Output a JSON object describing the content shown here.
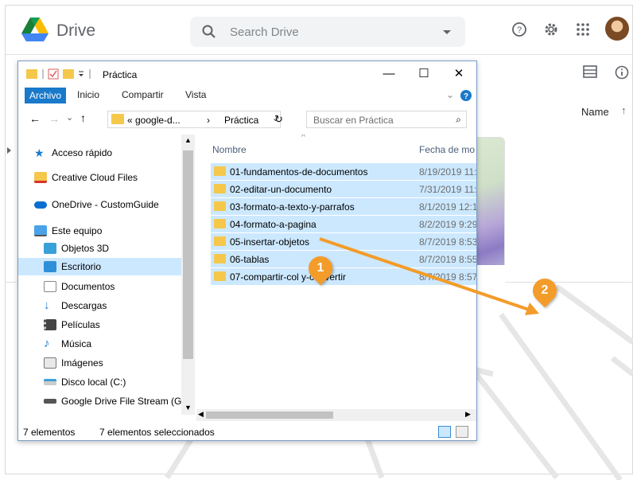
{
  "drive": {
    "title": "Drive",
    "search_placeholder": "Search Drive",
    "name_column": "Name",
    "sort_arrow": "↑"
  },
  "explorer": {
    "title": "Práctica",
    "ribbon_tabs": [
      "Archivo",
      "Inicio",
      "Compartir",
      "Vista"
    ],
    "address_prefix": "« google-d...",
    "address_current": "Práctica",
    "search_placeholder": "Buscar en Práctica",
    "nav_items": [
      {
        "label": "Acceso rápido",
        "icon": "star-icon"
      },
      {
        "label": "Creative Cloud Files",
        "icon": "creative-cloud-icon"
      },
      {
        "label": "OneDrive - CustomGuide",
        "icon": "onedrive-icon"
      },
      {
        "label": "Este equipo",
        "icon": "computer-icon"
      },
      {
        "label": "Objetos 3D",
        "icon": "3d-objects-icon"
      },
      {
        "label": "Escritorio",
        "icon": "desktop-icon"
      },
      {
        "label": "Documentos",
        "icon": "documents-icon"
      },
      {
        "label": "Descargas",
        "icon": "downloads-icon"
      },
      {
        "label": "Películas",
        "icon": "movies-icon"
      },
      {
        "label": "Música",
        "icon": "music-icon"
      },
      {
        "label": "Imágenes",
        "icon": "images-icon"
      },
      {
        "label": "Disco local (C:)",
        "icon": "drive-icon"
      },
      {
        "label": "Google Drive File Stream (G:)",
        "icon": "drive-stream-icon"
      }
    ],
    "columns": {
      "name": "Nombre",
      "date": "Fecha de mo"
    },
    "files": [
      {
        "name": "01-fundamentos-de-documentos",
        "date": "8/19/2019 11:"
      },
      {
        "name": "02-editar-un-documento",
        "date": "7/31/2019 11:"
      },
      {
        "name": "03-formato-a-texto-y-parrafos",
        "date": "8/1/2019 12:1"
      },
      {
        "name": "04-formato-a-pagina",
        "date": "8/2/2019 9:29"
      },
      {
        "name": "05-insertar-objetos",
        "date": "8/7/2019 8:53"
      },
      {
        "name": "06-tablas",
        "date": "8/7/2019 8:55"
      },
      {
        "name": "07-compartir-col        y-convertir",
        "date": "8/7/2019 8:57"
      }
    ],
    "status_count": "7 elementos",
    "status_selected": "7 elementos seleccionados"
  },
  "callouts": [
    "1",
    "2"
  ],
  "colors": {
    "accent": "#1979ca",
    "selection": "#cce8ff",
    "callout": "#f39c2a",
    "folder": "#f5c84c"
  }
}
